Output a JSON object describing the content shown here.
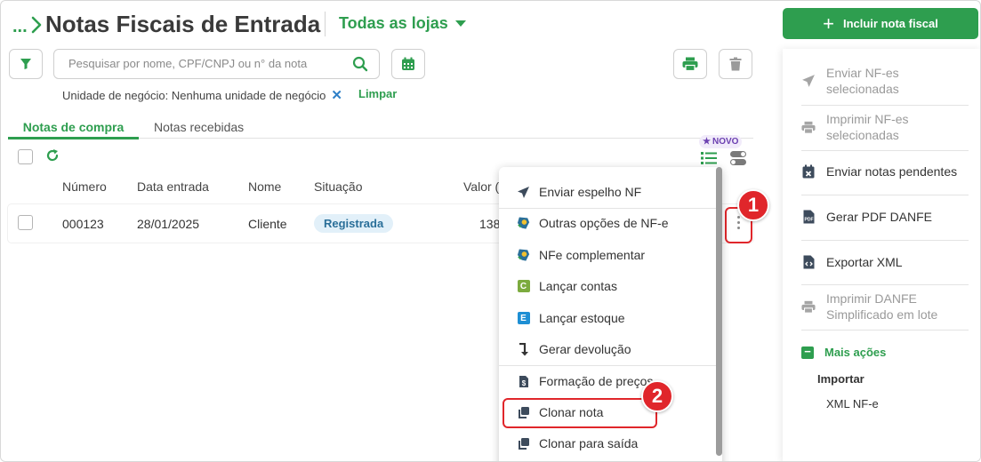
{
  "header": {
    "breadcrumb": "...",
    "title": "Notas Fiscais de Entrada",
    "store_selector": "Todas as lojas",
    "primary_action": "Incluir nota fiscal"
  },
  "toolbar": {
    "search_placeholder": "Pesquisar por nome, CPF/CNPJ ou n° da nota",
    "filter_chip": "Unidade de negócio: Nenhuma unidade de negócio",
    "clear_label": "Limpar"
  },
  "tabs": [
    {
      "label": "Notas de compra",
      "active": true
    },
    {
      "label": "Notas recebidas",
      "active": false
    }
  ],
  "table": {
    "badge": "NOVO",
    "columns": [
      "Número",
      "Data entrada",
      "Nome",
      "Situação",
      "Valor (R"
    ],
    "rows": [
      {
        "numero": "000123",
        "data": "28/01/2025",
        "nome": "Cliente",
        "situacao": "Registrada",
        "valor": "138"
      }
    ]
  },
  "context_menu": {
    "items": [
      {
        "label": "Enviar espelho NF",
        "icon": "send-icon"
      },
      {
        "label": "Outras opções de NF-e",
        "icon": "nfe-map-icon"
      },
      {
        "label": "NFe complementar",
        "icon": "nfe-map-icon"
      },
      {
        "label": "Lançar contas",
        "icon": "letter-c-icon",
        "letter": "C"
      },
      {
        "label": "Lançar estoque",
        "icon": "letter-e-icon",
        "letter": "E"
      },
      {
        "label": "Gerar devolução",
        "icon": "return-arrow-icon"
      },
      {
        "label": "Formação de preços",
        "icon": "price-doc-icon"
      },
      {
        "label": "Clonar nota",
        "icon": "clone-icon"
      },
      {
        "label": "Clonar para saída",
        "icon": "clone-icon"
      }
    ]
  },
  "markers": [
    "1",
    "2"
  ],
  "side_panel": {
    "items": [
      {
        "label": "Enviar NF-es selecionadas",
        "enabled": false
      },
      {
        "label": "Imprimir NF-es selecionadas",
        "enabled": false
      },
      {
        "label": "Enviar notas pendentes",
        "enabled": true
      },
      {
        "label": "Gerar PDF DANFE",
        "enabled": true
      },
      {
        "label": "Exportar XML",
        "enabled": true
      },
      {
        "label": "Imprimir DANFE Simplificado em lote",
        "enabled": false
      }
    ],
    "more_actions": "Mais ações",
    "import_label": "Importar",
    "import_item": "XML NF-e"
  },
  "colors": {
    "brand_green": "#2e9e4f",
    "marker_red": "#e0262b",
    "status_blue": "#2a6f99",
    "badge_purple": "#6b3fb0"
  }
}
